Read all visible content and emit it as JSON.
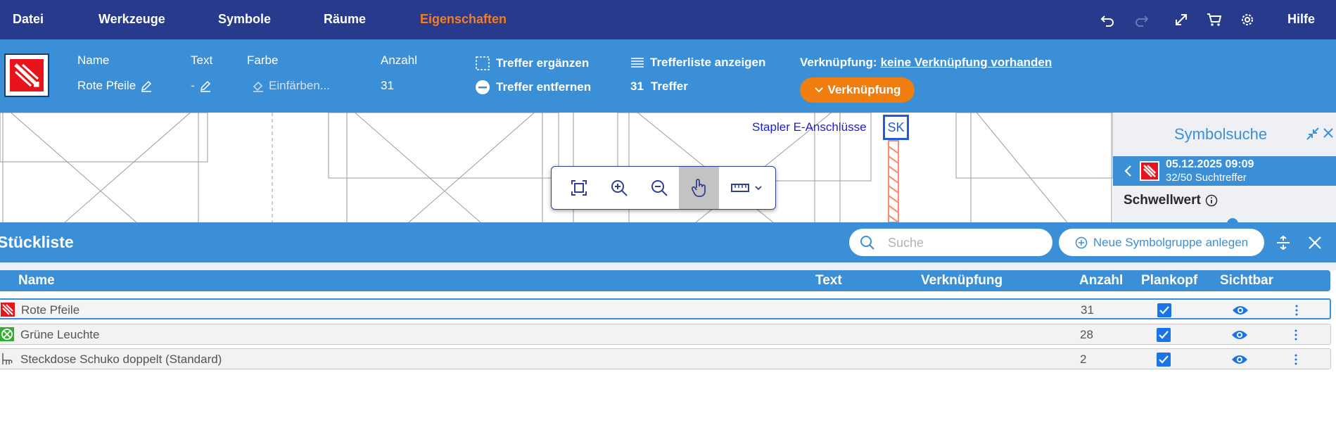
{
  "menu": {
    "items": [
      "Datei",
      "Werkzeuge",
      "Symbole",
      "Räume",
      "Eigenschaften"
    ],
    "active": "Eigenschaften",
    "help": "Hilfe"
  },
  "properties": {
    "name_label": "Name",
    "name_value": "Rote Pfeile",
    "text_label": "Text",
    "text_value": "-",
    "color_label": "Farbe",
    "color_placeholder": "Einfärben...",
    "count_label": "Anzahl",
    "count_value": "31",
    "add_hits": "Treffer ergänzen",
    "remove_hits": "Treffer entfernen",
    "show_hitlist": "Trefferliste anzeigen",
    "hits_count": "31",
    "hits_label": "Treffer",
    "link_label": "Verknüpfung:",
    "link_value": "keine Verknüpfung vorhanden",
    "link_button": "Verknüpfung"
  },
  "canvas": {
    "label": "Stapler E-Anschlüsse",
    "box_text": "SK"
  },
  "side_panel": {
    "title": "Symbolsuche",
    "result_date": "05.12.2025 09:09",
    "result_count": "32/50 Suchtreffer",
    "threshold_label": "Schwellwert"
  },
  "parts_list": {
    "title": "Stückliste",
    "search_placeholder": "Suche",
    "new_group_button": "Neue Symbolgruppe anlegen",
    "columns": {
      "name": "Name",
      "text": "Text",
      "link": "Verknüpfung",
      "count": "Anzahl",
      "plan_header": "Plankopf",
      "visible": "Sichtbar"
    },
    "rows": [
      {
        "name": "Rote Pfeile",
        "count": "31",
        "icon": "red-arrows-icon"
      },
      {
        "name": "Grüne Leuchte",
        "count": "28",
        "icon": "green-light-icon"
      },
      {
        "name": "Steckdose Schuko doppelt (Standard)",
        "count": "2",
        "icon": "socket-icon"
      }
    ]
  },
  "colors": {
    "topbar": "#273a8c",
    "primary": "#3a8fd6",
    "accent_orange": "#f07d10",
    "active_menu": "#f57c1f",
    "checkbox": "#1a73e8"
  }
}
